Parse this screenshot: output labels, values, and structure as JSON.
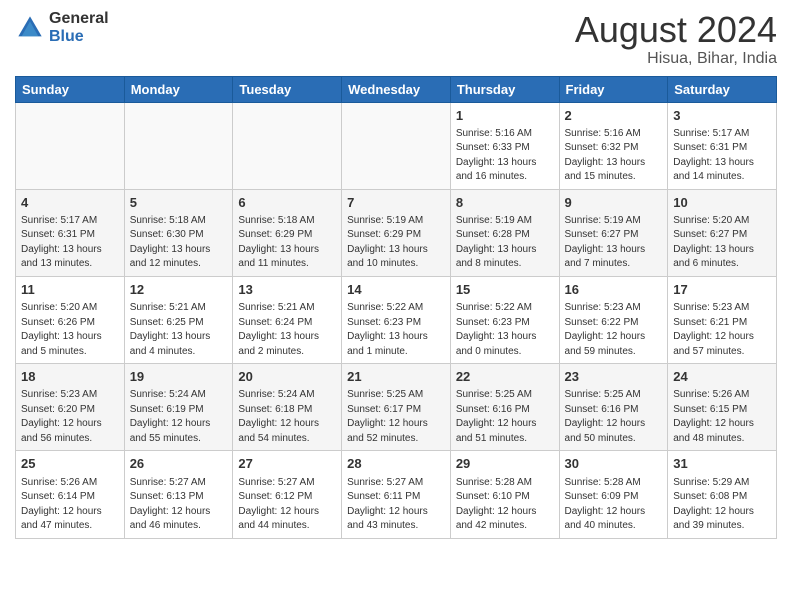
{
  "logo": {
    "general": "General",
    "blue": "Blue"
  },
  "header": {
    "month": "August 2024",
    "location": "Hisua, Bihar, India"
  },
  "days_of_week": [
    "Sunday",
    "Monday",
    "Tuesday",
    "Wednesday",
    "Thursday",
    "Friday",
    "Saturday"
  ],
  "weeks": [
    [
      {
        "num": "",
        "info": ""
      },
      {
        "num": "",
        "info": ""
      },
      {
        "num": "",
        "info": ""
      },
      {
        "num": "",
        "info": ""
      },
      {
        "num": "1",
        "info": "Sunrise: 5:16 AM\nSunset: 6:33 PM\nDaylight: 13 hours\nand 16 minutes."
      },
      {
        "num": "2",
        "info": "Sunrise: 5:16 AM\nSunset: 6:32 PM\nDaylight: 13 hours\nand 15 minutes."
      },
      {
        "num": "3",
        "info": "Sunrise: 5:17 AM\nSunset: 6:31 PM\nDaylight: 13 hours\nand 14 minutes."
      }
    ],
    [
      {
        "num": "4",
        "info": "Sunrise: 5:17 AM\nSunset: 6:31 PM\nDaylight: 13 hours\nand 13 minutes."
      },
      {
        "num": "5",
        "info": "Sunrise: 5:18 AM\nSunset: 6:30 PM\nDaylight: 13 hours\nand 12 minutes."
      },
      {
        "num": "6",
        "info": "Sunrise: 5:18 AM\nSunset: 6:29 PM\nDaylight: 13 hours\nand 11 minutes."
      },
      {
        "num": "7",
        "info": "Sunrise: 5:19 AM\nSunset: 6:29 PM\nDaylight: 13 hours\nand 10 minutes."
      },
      {
        "num": "8",
        "info": "Sunrise: 5:19 AM\nSunset: 6:28 PM\nDaylight: 13 hours\nand 8 minutes."
      },
      {
        "num": "9",
        "info": "Sunrise: 5:19 AM\nSunset: 6:27 PM\nDaylight: 13 hours\nand 7 minutes."
      },
      {
        "num": "10",
        "info": "Sunrise: 5:20 AM\nSunset: 6:27 PM\nDaylight: 13 hours\nand 6 minutes."
      }
    ],
    [
      {
        "num": "11",
        "info": "Sunrise: 5:20 AM\nSunset: 6:26 PM\nDaylight: 13 hours\nand 5 minutes."
      },
      {
        "num": "12",
        "info": "Sunrise: 5:21 AM\nSunset: 6:25 PM\nDaylight: 13 hours\nand 4 minutes."
      },
      {
        "num": "13",
        "info": "Sunrise: 5:21 AM\nSunset: 6:24 PM\nDaylight: 13 hours\nand 2 minutes."
      },
      {
        "num": "14",
        "info": "Sunrise: 5:22 AM\nSunset: 6:23 PM\nDaylight: 13 hours\nand 1 minute."
      },
      {
        "num": "15",
        "info": "Sunrise: 5:22 AM\nSunset: 6:23 PM\nDaylight: 13 hours\nand 0 minutes."
      },
      {
        "num": "16",
        "info": "Sunrise: 5:23 AM\nSunset: 6:22 PM\nDaylight: 12 hours\nand 59 minutes."
      },
      {
        "num": "17",
        "info": "Sunrise: 5:23 AM\nSunset: 6:21 PM\nDaylight: 12 hours\nand 57 minutes."
      }
    ],
    [
      {
        "num": "18",
        "info": "Sunrise: 5:23 AM\nSunset: 6:20 PM\nDaylight: 12 hours\nand 56 minutes."
      },
      {
        "num": "19",
        "info": "Sunrise: 5:24 AM\nSunset: 6:19 PM\nDaylight: 12 hours\nand 55 minutes."
      },
      {
        "num": "20",
        "info": "Sunrise: 5:24 AM\nSunset: 6:18 PM\nDaylight: 12 hours\nand 54 minutes."
      },
      {
        "num": "21",
        "info": "Sunrise: 5:25 AM\nSunset: 6:17 PM\nDaylight: 12 hours\nand 52 minutes."
      },
      {
        "num": "22",
        "info": "Sunrise: 5:25 AM\nSunset: 6:16 PM\nDaylight: 12 hours\nand 51 minutes."
      },
      {
        "num": "23",
        "info": "Sunrise: 5:25 AM\nSunset: 6:16 PM\nDaylight: 12 hours\nand 50 minutes."
      },
      {
        "num": "24",
        "info": "Sunrise: 5:26 AM\nSunset: 6:15 PM\nDaylight: 12 hours\nand 48 minutes."
      }
    ],
    [
      {
        "num": "25",
        "info": "Sunrise: 5:26 AM\nSunset: 6:14 PM\nDaylight: 12 hours\nand 47 minutes."
      },
      {
        "num": "26",
        "info": "Sunrise: 5:27 AM\nSunset: 6:13 PM\nDaylight: 12 hours\nand 46 minutes."
      },
      {
        "num": "27",
        "info": "Sunrise: 5:27 AM\nSunset: 6:12 PM\nDaylight: 12 hours\nand 44 minutes."
      },
      {
        "num": "28",
        "info": "Sunrise: 5:27 AM\nSunset: 6:11 PM\nDaylight: 12 hours\nand 43 minutes."
      },
      {
        "num": "29",
        "info": "Sunrise: 5:28 AM\nSunset: 6:10 PM\nDaylight: 12 hours\nand 42 minutes."
      },
      {
        "num": "30",
        "info": "Sunrise: 5:28 AM\nSunset: 6:09 PM\nDaylight: 12 hours\nand 40 minutes."
      },
      {
        "num": "31",
        "info": "Sunrise: 5:29 AM\nSunset: 6:08 PM\nDaylight: 12 hours\nand 39 minutes."
      }
    ]
  ]
}
